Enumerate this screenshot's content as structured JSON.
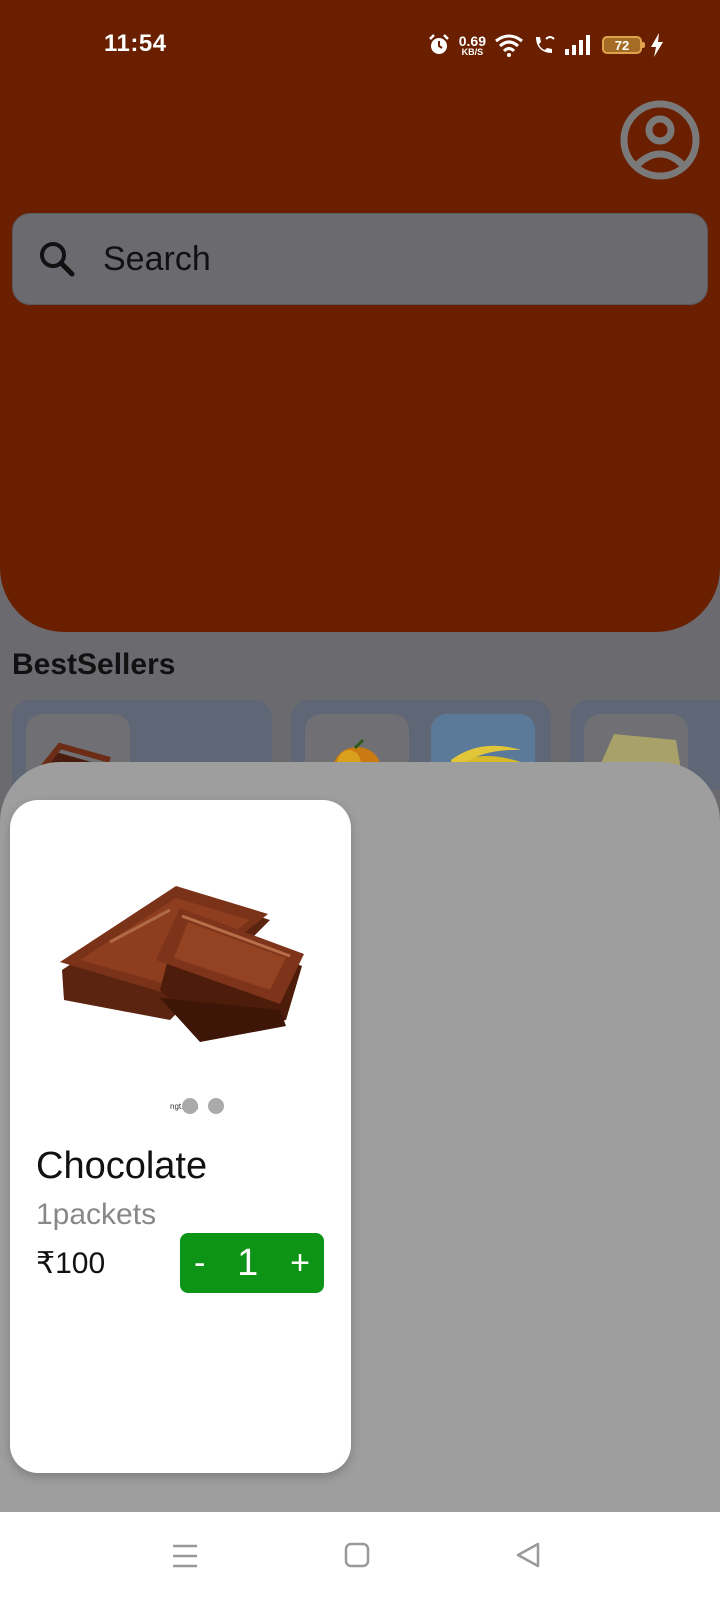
{
  "status_bar": {
    "time": "11:54",
    "network_speed_value": "0.69",
    "network_speed_unit": "KB/S",
    "battery_level": "72"
  },
  "header": {
    "profile_icon": "user-circle-icon"
  },
  "search": {
    "placeholder": "Search",
    "value": ""
  },
  "bestsellers": {
    "title": "BestSellers",
    "items": [
      {
        "thumb": "chocolate"
      },
      {
        "thumb": "mango"
      },
      {
        "thumb": "banana"
      },
      {
        "thumb": "cake"
      }
    ]
  },
  "product_sheet": {
    "product": {
      "name": "Chocolate",
      "quantity": "1packets",
      "price": "₹100",
      "count": "1",
      "decrement_label": "-",
      "increment_label": "+",
      "image": "chocolate-bar"
    },
    "image_watermark": "ngt.com"
  },
  "colors": {
    "header_brown": "#6a2000",
    "stepper_green": "#0d9316",
    "sheet_overlay": "#9e9e9e"
  },
  "nav_bar": {
    "icons": [
      "menu-icon",
      "home-square-icon",
      "back-triangle-icon"
    ]
  }
}
